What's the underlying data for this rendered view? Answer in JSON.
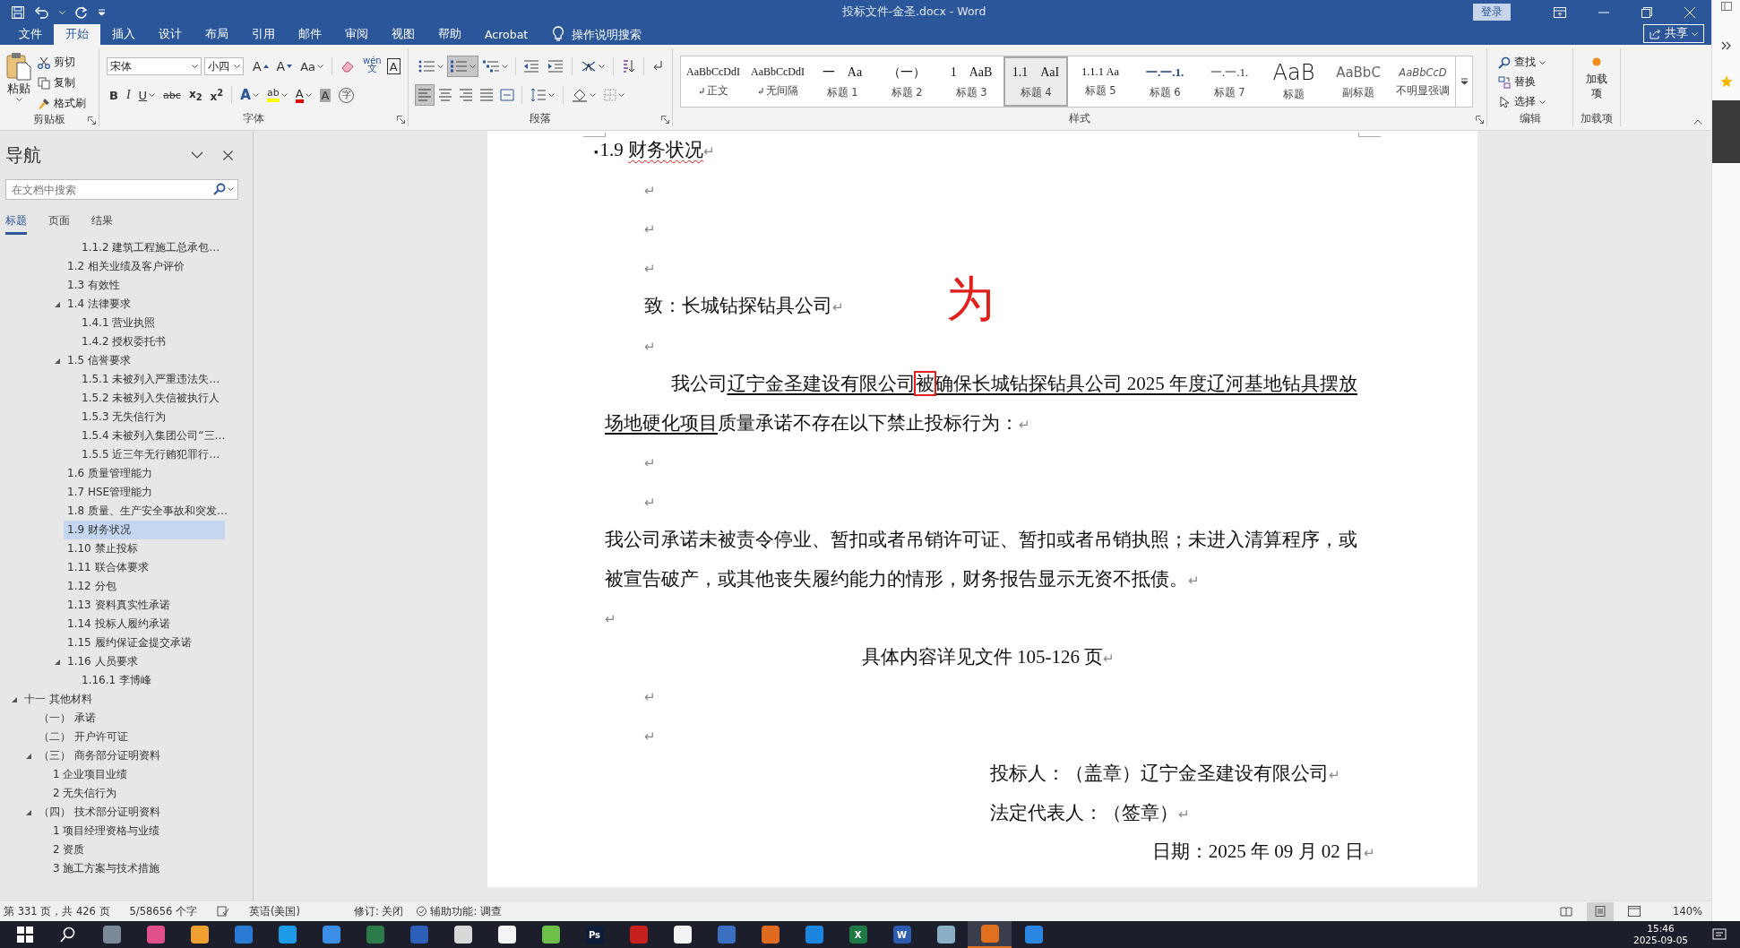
{
  "title_bar": {
    "title": "投标文件-金圣.docx  -  Word",
    "sign_in": "登录"
  },
  "ribbon_tabs": [
    {
      "label": "文件",
      "selected": false
    },
    {
      "label": "开始",
      "selected": true
    },
    {
      "label": "插入",
      "selected": false
    },
    {
      "label": "设计",
      "selected": false
    },
    {
      "label": "布局",
      "selected": false
    },
    {
      "label": "引用",
      "selected": false
    },
    {
      "label": "邮件",
      "selected": false
    },
    {
      "label": "审阅",
      "selected": false
    },
    {
      "label": "视图",
      "selected": false
    },
    {
      "label": "帮助",
      "selected": false
    },
    {
      "label": "Acrobat",
      "selected": false
    }
  ],
  "tell_me": "操作说明搜索",
  "share": "共享",
  "clipboard": {
    "paste": "粘贴",
    "cut": "剪切",
    "copy": "复制",
    "format_painter": "格式刷",
    "label": "剪贴板"
  },
  "font": {
    "name": "宋体",
    "size": "小四",
    "label": "字体",
    "row1": [
      {
        "kind": "grow",
        "label": "A"
      },
      {
        "kind": "shrink",
        "label": "A"
      },
      {
        "kind": "case",
        "label": "Aa"
      },
      {
        "kind": "clear"
      },
      {
        "kind": "phonetic",
        "label": "wén",
        "sub": "文"
      },
      {
        "kind": "border",
        "label": "A"
      }
    ],
    "row2": [
      {
        "kind": "bold",
        "label": "B"
      },
      {
        "kind": "italic",
        "label": "I"
      },
      {
        "kind": "underline",
        "label": "U"
      },
      {
        "kind": "strike",
        "label": "abc"
      },
      {
        "kind": "subscript",
        "label": "x$_{2}$"
      },
      {
        "kind": "superscript",
        "label": "x$^{2}$"
      },
      {
        "kind": "effect",
        "label": "A"
      },
      {
        "kind": "highlight",
        "label": "ab"
      },
      {
        "kind": "color",
        "label": "A"
      },
      {
        "kind": "shading",
        "label": "A"
      },
      {
        "kind": "enclose",
        "label": "字"
      }
    ]
  },
  "paragraph": {
    "label": "段落",
    "list_buttons": [
      {
        "kind": "bullets",
        "on": false
      },
      {
        "kind": "numbering",
        "on": true
      },
      {
        "kind": "multilevel",
        "on": false
      }
    ],
    "align_buttons": [
      {
        "kind": "left",
        "on": true
      },
      {
        "kind": "center",
        "on": false
      },
      {
        "kind": "right",
        "on": false
      },
      {
        "kind": "justify",
        "on": false
      },
      {
        "kind": "distributed",
        "on": false
      }
    ]
  },
  "styles": {
    "label": "样式",
    "items": [
      {
        "preview": "AaBbCcDdI",
        "name": "正文",
        "kind": "body",
        "selected": false
      },
      {
        "preview": "AaBbCcDdI",
        "name": "无间隔",
        "kind": "body",
        "selected": false
      },
      {
        "preview": "一　Aa",
        "name": "标题 1",
        "kind": "heading",
        "selected": false
      },
      {
        "preview": "（一）",
        "name": "标题 2",
        "kind": "heading",
        "selected": false
      },
      {
        "preview": "1　AaB",
        "name": "标题 3",
        "kind": "heading",
        "selected": false
      },
      {
        "preview": "1.1　AaI",
        "name": "标题 4",
        "kind": "heading",
        "selected": true
      },
      {
        "preview": "1.1.1 Aa",
        "name": "标题 5",
        "kind": "heading-small",
        "selected": false
      },
      {
        "preview": "一.一.1.",
        "name": "标题 6",
        "kind": "heading-blue",
        "selected": false
      },
      {
        "preview": "一.一.1.",
        "name": "标题 7",
        "kind": "heading-plain",
        "selected": false
      },
      {
        "preview": "AaB",
        "name": "标题",
        "kind": "title",
        "selected": false
      },
      {
        "preview": "AaBbC",
        "name": "副标题",
        "kind": "subtitle",
        "selected": false
      },
      {
        "preview": "AaBbCcD",
        "name": "不明显强调",
        "kind": "subtle",
        "selected": false
      }
    ]
  },
  "editing": {
    "find": "查找",
    "replace": "替换",
    "select": "选择",
    "label": "编辑"
  },
  "addins": {
    "button": "加载项",
    "label": "加载项"
  },
  "nav": {
    "title": "导航",
    "search_placeholder": "在文档中搜索",
    "tabs": [
      {
        "label": "标题",
        "selected": true
      },
      {
        "label": "页面",
        "selected": false
      },
      {
        "label": "结果",
        "selected": false
      }
    ],
    "outline": [
      {
        "children": [
          {
            "children": [
              {
                "children": [
                  {
                    "children": [
                      {
                        "label": "1.1.2 建筑工程施工总承包…",
                        "selected": false
                      }
                    ]
                  },
                  {
                    "label": "1.2 相关业绩及客户评价",
                    "selected": false
                  },
                  {
                    "label": "1.3 有效性",
                    "selected": false
                  },
                  {
                    "label": "1.4 法律要求",
                    "selected": false,
                    "expanded": true,
                    "children": [
                      {
                        "label": "1.4.1 营业执照",
                        "selected": false
                      },
                      {
                        "label": "1.4.2 授权委托书",
                        "selected": false
                      }
                    ]
                  },
                  {
                    "label": "1.5 信誉要求",
                    "selected": false,
                    "expanded": true,
                    "children": [
                      {
                        "label": "1.5.1 未被列入严重违法失…",
                        "selected": false
                      },
                      {
                        "label": "1.5.2 未被列入失信被执行人",
                        "selected": false
                      },
                      {
                        "label": "1.5.3 无失信行为",
                        "selected": false
                      },
                      {
                        "label": "1.5.4 未被列入集团公司“三…",
                        "selected": false
                      },
                      {
                        "label": "1.5.5 近三年无行贿犯罪行…",
                        "selected": false
                      }
                    ]
                  },
                  {
                    "label": "1.6 质量管理能力",
                    "selected": false
                  },
                  {
                    "label": "1.7 HSE管理能力",
                    "selected": false
                  },
                  {
                    "label": "1.8 质量、生产安全事故和突发…",
                    "selected": false
                  },
                  {
                    "label": "1.9 财务状况",
                    "selected": true
                  },
                  {
                    "label": "1.10 禁止投标",
                    "selected": false
                  },
                  {
                    "label": "1.11 联合体要求",
                    "selected": false
                  },
                  {
                    "label": "1.12 分包",
                    "selected": false
                  },
                  {
                    "label": "1.13 资料真实性承诺",
                    "selected": false
                  },
                  {
                    "label": "1.14 投标人履约承诺",
                    "selected": false
                  },
                  {
                    "label": "1.15 履约保证金提交承诺",
                    "selected": false
                  },
                  {
                    "label": "1.16 人员要求",
                    "selected": false,
                    "expanded": true,
                    "children": [
                      {
                        "label": "1.16.1 李博峰",
                        "selected": false
                      }
                    ]
                  }
                ]
              }
            ]
          }
        ]
      },
      {
        "label": "十一 其他材料",
        "selected": false,
        "expanded": true,
        "children": [
          {
            "label": "（一） 承诺",
            "selected": false
          },
          {
            "label": "（二） 开户许可证",
            "selected": false
          },
          {
            "label": "（三） 商务部分证明资料",
            "selected": false,
            "expanded": true,
            "children": [
              {
                "label": "1 企业项目业绩",
                "selected": false
              },
              {
                "label": "2 无失信行为",
                "selected": false
              }
            ]
          },
          {
            "label": "（四） 技术部分证明资料",
            "selected": false,
            "expanded": true,
            "children": [
              {
                "label": "1 项目经理资格与业绩",
                "selected": false
              },
              {
                "label": "2 资质",
                "selected": false
              },
              {
                "label": "3 施工方案与技术措施",
                "selected": false
              }
            ]
          }
        ]
      }
    ]
  },
  "document": {
    "annotation": "为",
    "paragraphs": [
      {
        "kind": "heading",
        "bullet": "▪",
        "number": "1.9",
        "text": "财务状况",
        "spelling_error": true,
        "mark": "↵"
      },
      {
        "kind": "blank-indented",
        "mark": "↵"
      },
      {
        "kind": "blank-indented",
        "mark": "↵"
      },
      {
        "kind": "blank-indented",
        "mark": "↵"
      },
      {
        "kind": "text-indented",
        "runs": [
          {
            "text": "致：长城钻探钻具公司",
            "underline": false,
            "boxed": false
          }
        ],
        "mark": "↵"
      },
      {
        "kind": "blank-indented",
        "mark": "↵"
      },
      {
        "kind": "text-wide-indent",
        "runs": [
          {
            "text": "我公司",
            "underline": false,
            "boxed": false
          },
          {
            "text": "辽宁金圣建设有限公司",
            "underline": true,
            "boxed": false
          },
          {
            "text": "被",
            "underline": false,
            "boxed": true
          },
          {
            "text": "确保长城钻探钻具公司 2025 年度辽河基地钻具摆放场地硬化项目",
            "underline": true,
            "boxed": false
          },
          {
            "text": "质量承诺不存在以下禁止投标行为：",
            "underline": false,
            "boxed": false
          }
        ],
        "mark": "↵"
      },
      {
        "kind": "blank-indented",
        "mark": "↵"
      },
      {
        "kind": "blank-indented",
        "mark": "↵"
      },
      {
        "kind": "text",
        "runs": [
          {
            "text": "我公司承诺未被责令停业、暂扣或者吊销许可证、暂扣或者吊销执照；未进入清算程序，或被宣告破产，或其他丧失履约能力的情形，财务报告显示无资不抵债。",
            "underline": false,
            "boxed": false
          }
        ],
        "mark": "↵"
      },
      {
        "kind": "blank",
        "mark": "↵"
      },
      {
        "kind": "center",
        "runs": [
          {
            "text": "具体内容详见文件 105-126 页",
            "underline": false,
            "boxed": false
          }
        ],
        "mark": "↵"
      },
      {
        "kind": "blank-indented",
        "mark": "↵"
      },
      {
        "kind": "blank-indented",
        "mark": "↵"
      },
      {
        "kind": "signature",
        "runs": [
          {
            "text": "投标人：（盖章）辽宁金圣建设有限公司",
            "underline": false,
            "boxed": false
          }
        ],
        "mark": "↵"
      },
      {
        "kind": "signature",
        "runs": [
          {
            "text": "法定代表人：（签章）",
            "underline": false,
            "boxed": false
          }
        ],
        "mark": "↵"
      },
      {
        "kind": "right",
        "runs": [
          {
            "text": "日期：2025 年 09 月  02 日",
            "underline": false,
            "boxed": false
          }
        ],
        "mark": "↵"
      }
    ]
  },
  "status_bar": {
    "page": "第 331 页，共 426 页",
    "words": "5/58656 个字",
    "language": "英语(美国)",
    "track_changes": "修订: 关闭",
    "accessibility": "辅助功能: 调查",
    "zoom": "140%",
    "views": [
      {
        "kind": "read",
        "selected": false
      },
      {
        "kind": "print",
        "selected": true
      },
      {
        "kind": "web",
        "selected": false
      }
    ]
  },
  "taskbar": {
    "time": "15:46",
    "date": "2025-09-05",
    "apps": [
      {
        "color": "#7a8a99",
        "active": false
      },
      {
        "color": "#e0508a",
        "active": false
      },
      {
        "color": "#f0a030",
        "active": false
      },
      {
        "color": "#2a7bd6",
        "active": false
      },
      {
        "color": "#1e9be8",
        "active": false
      },
      {
        "color": "#3a8ee6",
        "active": false
      },
      {
        "color": "#2d7a4a",
        "active": false
      },
      {
        "color": "#2b5fb8",
        "active": false
      },
      {
        "color": "#d8d8d8",
        "active": false
      },
      {
        "color": "#f4f4f4",
        "active": false
      },
      {
        "color": "#6cc04a",
        "active": false
      },
      {
        "color": "#0a1c3a",
        "label": "Ps",
        "active": false
      },
      {
        "color": "#c8201e",
        "active": false
      },
      {
        "color": "#f2f2f2",
        "active": false
      },
      {
        "color": "#3b6fc2",
        "active": false
      },
      {
        "color": "#e06a1e",
        "active": false
      },
      {
        "color": "#1a86e0",
        "active": false
      },
      {
        "color": "#1e7a44",
        "label": "X",
        "active": false
      },
      {
        "color": "#2b5cb0",
        "label": "W",
        "active": false
      },
      {
        "color": "#8ab0c8",
        "active": false
      },
      {
        "color": "#e0701e",
        "active": true
      },
      {
        "color": "#2a86e0",
        "active": false
      }
    ]
  }
}
